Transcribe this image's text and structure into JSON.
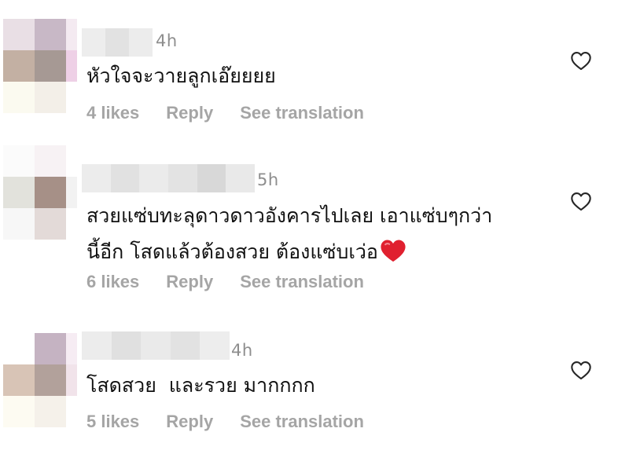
{
  "comments": [
    {
      "time": "4h",
      "text_lines": [
        "หัวใจจะวายลูกเอ๊ยยยย"
      ],
      "likes": "4 likes",
      "reply": "Reply",
      "translate": "See translation"
    },
    {
      "time": "5h",
      "text_lines": [
        "สวยแซ่บทะลุดาวดาวอังคารไปเลย เอาแซ่บๆกว่า",
        "นี้อีก โสดแล้วต้องสวย ต้องแซ่บเว่อ"
      ],
      "emoji": "red-heart-emoji",
      "likes": "6 likes",
      "reply": "Reply",
      "translate": "See translation"
    },
    {
      "time": "4h",
      "text_lines": [
        "โสดสวย  และรวย มากกกก"
      ],
      "likes": "5 likes",
      "reply": "Reply",
      "translate": "See translation"
    }
  ],
  "icons": {
    "like": "heart-outline-icon"
  },
  "colors": {
    "text": "#111111",
    "meta": "#8e8e8e",
    "actions": "#a5a5a5",
    "heart_emoji": "#e0202f"
  }
}
